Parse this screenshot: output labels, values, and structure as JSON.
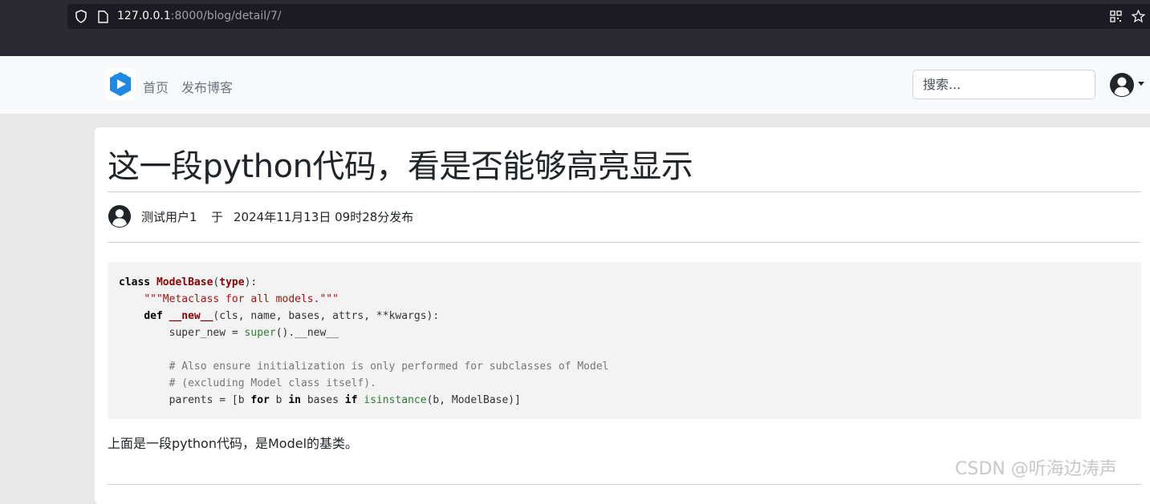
{
  "browser": {
    "url_host": "127.0.0.1",
    "url_path": ":8000/blog/detail/7/"
  },
  "navbar": {
    "links": [
      "首页",
      "发布博客"
    ],
    "search_placeholder": "搜索..."
  },
  "post": {
    "title": "这一段python代码，看是否能够高亮显示",
    "author": "测试用户1",
    "at_word": "于",
    "published": "2024年11月13日 09时28分发布",
    "code_lines": [
      [
        {
          "t": "class ",
          "c": "k"
        },
        {
          "t": "ModelBase",
          "c": "cls"
        },
        {
          "t": "(",
          "c": ""
        },
        {
          "t": "type",
          "c": "cls"
        },
        {
          "t": "):",
          "c": ""
        }
      ],
      [
        {
          "t": "    ",
          "c": ""
        },
        {
          "t": "\"\"\"Metaclass for all models.\"\"\"",
          "c": "str"
        }
      ],
      [
        {
          "t": "    ",
          "c": ""
        },
        {
          "t": "def ",
          "c": "k"
        },
        {
          "t": "__new__",
          "c": "cls"
        },
        {
          "t": "(cls, name, bases, attrs, **kwargs):",
          "c": ""
        }
      ],
      [
        {
          "t": "        super_new = ",
          "c": ""
        },
        {
          "t": "super",
          "c": "bi"
        },
        {
          "t": "().__new__",
          "c": ""
        }
      ],
      [
        {
          "t": "",
          "c": ""
        }
      ],
      [
        {
          "t": "        ",
          "c": ""
        },
        {
          "t": "# Also ensure initialization is only performed for subclasses of Model",
          "c": "cm"
        }
      ],
      [
        {
          "t": "        ",
          "c": ""
        },
        {
          "t": "# (excluding Model class itself).",
          "c": "cm"
        }
      ],
      [
        {
          "t": "        parents = [b ",
          "c": ""
        },
        {
          "t": "for",
          "c": "k"
        },
        {
          "t": " b ",
          "c": ""
        },
        {
          "t": "in",
          "c": "k"
        },
        {
          "t": " bases ",
          "c": ""
        },
        {
          "t": "if",
          "c": "k"
        },
        {
          "t": " ",
          "c": ""
        },
        {
          "t": "isinstance",
          "c": "bi"
        },
        {
          "t": "(b, ModelBase)]",
          "c": ""
        }
      ]
    ],
    "body_text": "上面是一段python代码，是Model的基类。"
  },
  "watermark": "CSDN @听海边涛声",
  "colors": {
    "browser_chrome": "#2b2a33",
    "navbar_bg": "#f8f9fa",
    "page_bg": "#e8e8e8",
    "brand_blue": "#1e88e5",
    "code_bg": "#f3f3f3"
  }
}
